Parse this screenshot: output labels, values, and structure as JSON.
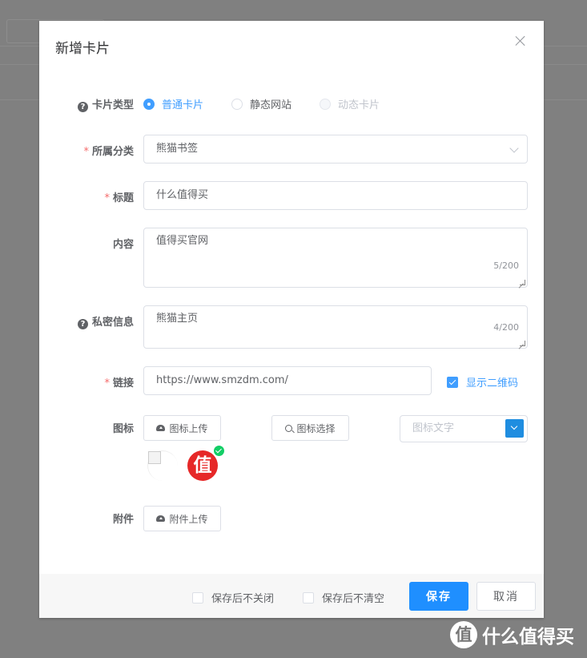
{
  "dialog": {
    "title": "新增卡片",
    "close_icon": "close-icon"
  },
  "form": {
    "card_type": {
      "label": "卡片类型",
      "options": [
        {
          "label": "普通卡片",
          "state": "checked"
        },
        {
          "label": "静态网站",
          "state": "unchecked"
        },
        {
          "label": "动态卡片",
          "state": "disabled"
        }
      ]
    },
    "category": {
      "label": "所属分类",
      "value": "熊猫书签"
    },
    "title": {
      "label": "标题",
      "value": "什么值得买"
    },
    "content": {
      "label": "内容",
      "value": "值得买官网",
      "count": "5/200"
    },
    "private": {
      "label": "私密信息",
      "value": "熊猫主页",
      "count": "4/200"
    },
    "link": {
      "label": "链接",
      "value": "https://www.smzdm.com/",
      "qr_label": "显示二维码",
      "qr_checked": true
    },
    "icon": {
      "label": "图标",
      "upload_label": "图标上传",
      "choose_label": "图标选择",
      "text_placeholder": "图标文字",
      "logo_char": "值"
    },
    "attachment": {
      "label": "附件",
      "upload_label": "附件上传"
    }
  },
  "footer": {
    "keep_open_label": "保存后不关闭",
    "keep_data_label": "保存后不清空",
    "save_label": "保存",
    "cancel_label": "取消"
  },
  "watermark": {
    "logo_char": "值",
    "text": "什么值得买"
  },
  "colors": {
    "primary": "#409eff",
    "required": "#f56c6c",
    "logo_red": "#e62828",
    "success": "#13ce66"
  }
}
